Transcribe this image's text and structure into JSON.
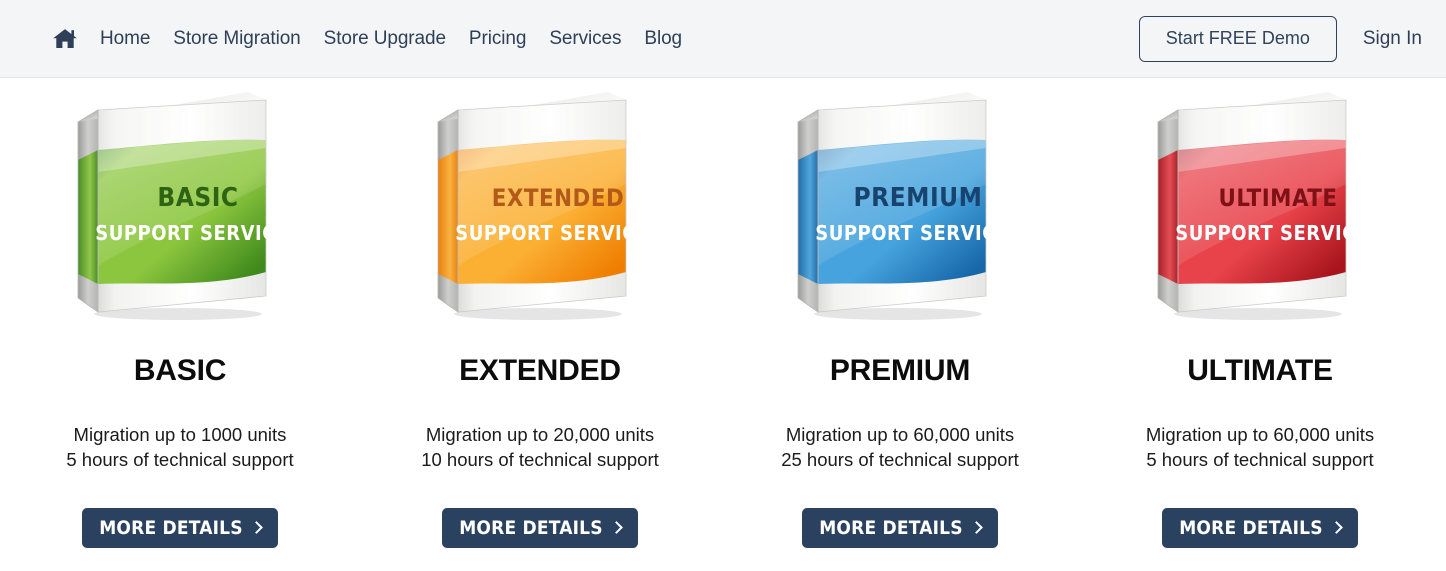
{
  "header": {
    "home_icon": "home-icon",
    "nav_items": [
      {
        "label": "Home"
      },
      {
        "label": "Store Migration"
      },
      {
        "label": "Store Upgrade"
      },
      {
        "label": "Pricing"
      },
      {
        "label": "Services"
      },
      {
        "label": "Blog"
      }
    ],
    "demo_button": "Start FREE Demo",
    "signin_label": "Sign In",
    "background": "#f4f5f6",
    "text_color": "#2f3f57"
  },
  "plans": [
    {
      "name": "BASIC",
      "box_title": "BASIC",
      "box_subtitle": "SUPPORT SERVICE",
      "band_color_light": "#8cc63e",
      "band_color_dark": "#3f8a1c",
      "band_title_color": "#2d6313",
      "desc_line1": "Migration up to 1000 units",
      "desc_line2": "5 hours of technical support",
      "cta_label": "MORE DETAILS"
    },
    {
      "name": "EXTENDED",
      "box_title": "EXTENDED",
      "box_subtitle": "SUPPORT SERVICE",
      "band_color_light": "#fbb034",
      "band_color_dark": "#ef7d00",
      "band_title_color": "#b35a18",
      "desc_line1": "Migration up to 20,000 units",
      "desc_line2": "10 hours of technical support",
      "cta_label": "MORE DETAILS"
    },
    {
      "name": "PREMIUM",
      "box_title": "PREMIUM",
      "box_subtitle": "SUPPORT SERVICE",
      "band_color_light": "#46a3dd",
      "band_color_dark": "#1667a8",
      "band_title_color": "#17436e",
      "desc_line1": "Migration up to 60,000 units",
      "desc_line2": "25 hours of technical support",
      "cta_label": "MORE DETAILS"
    },
    {
      "name": "ULTIMATE",
      "box_title": "ULTIMATE",
      "box_subtitle": "SUPPORT SERVICE",
      "band_color_light": "#e8424a",
      "band_color_dark": "#a8141c",
      "band_title_color": "#7e1016",
      "desc_line1": "Migration up to 60,000 units",
      "desc_line2": "5 hours of technical support",
      "cta_label": "MORE DETAILS"
    }
  ],
  "theme": {
    "cta_bg": "#2b4160",
    "cta_text": "#ffffff",
    "page_bg": "#ffffff"
  }
}
